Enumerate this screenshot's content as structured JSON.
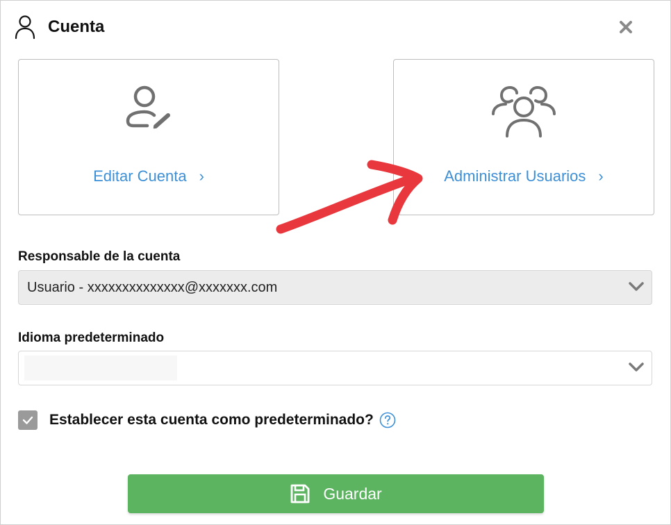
{
  "dialog": {
    "title": "Cuenta",
    "icons": {
      "title": "user-icon",
      "close": "close-icon"
    }
  },
  "cards": {
    "edit": {
      "label": "Editar Cuenta",
      "icon": "user-edit-icon"
    },
    "admin": {
      "label": "Administrar Usuarios",
      "icon": "users-group-icon"
    }
  },
  "owner_field": {
    "label": "Responsable de la cuenta",
    "value": "Usuario - xxxxxxxxxxxxxx@xxxxxxx.com"
  },
  "language_field": {
    "label": "Idioma predeterminado",
    "value": ""
  },
  "default_checkbox": {
    "label": "Establecer esta cuenta como predeterminado?",
    "checked": true
  },
  "save_button": {
    "label": "Guardar",
    "icon": "save-icon"
  },
  "colors": {
    "link": "#3d8fd6",
    "save": "#5cb360",
    "annotation_arrow": "#e8383d",
    "checkbox": "#9a9a9a"
  }
}
